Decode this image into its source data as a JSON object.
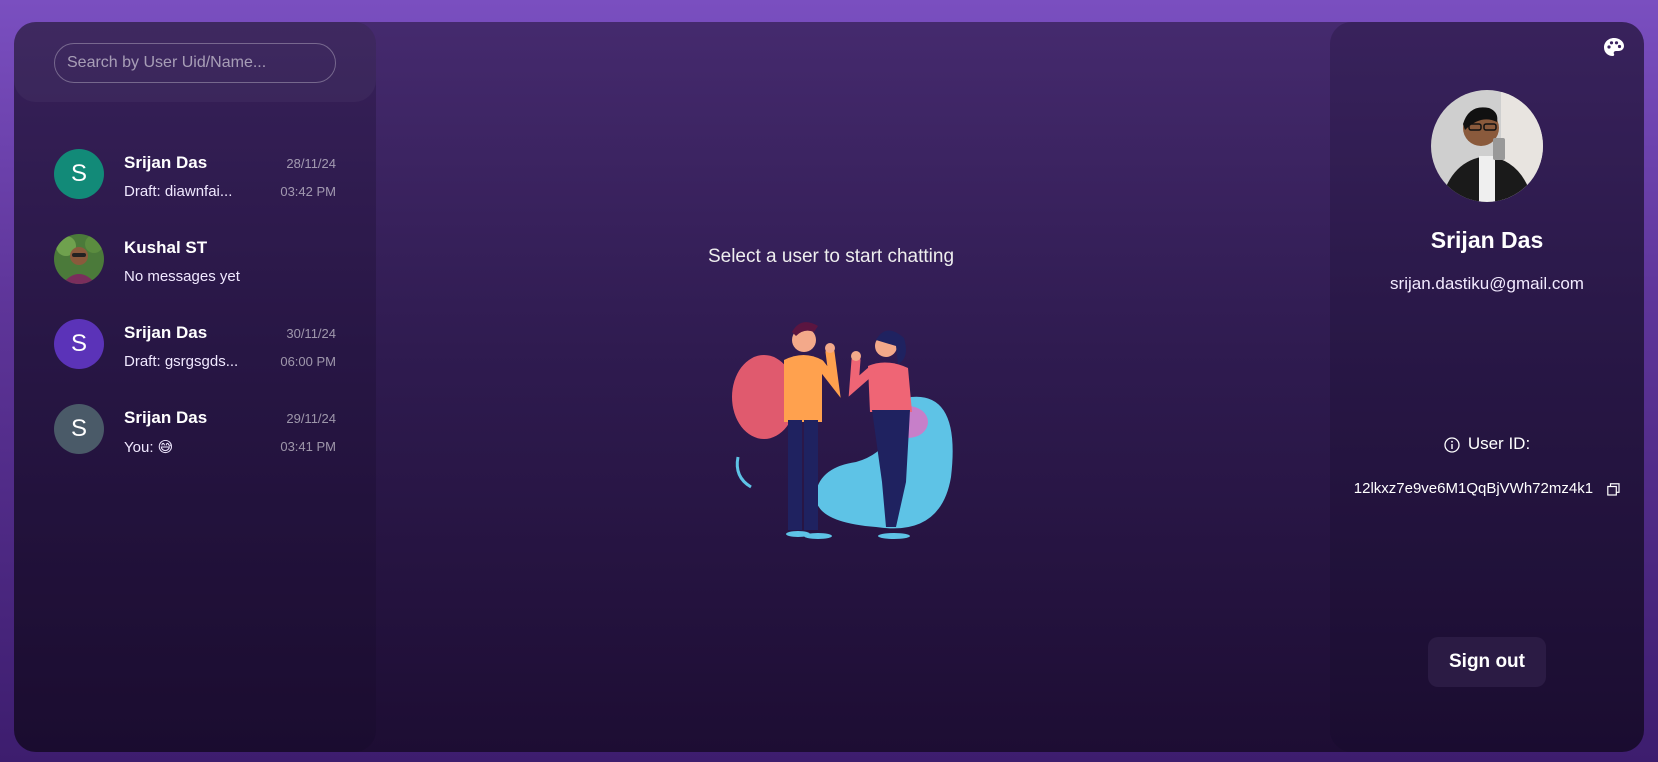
{
  "search": {
    "placeholder": "Search by User Uid/Name..."
  },
  "chats": [
    {
      "name": "Srijan Das",
      "preview": "Draft: diawnfai...",
      "date": "28/11/24",
      "time": "03:42 PM",
      "initial": "S",
      "avatar_color": "#128a78"
    },
    {
      "name": "Kushal ST",
      "preview": "No messages yet",
      "date": "",
      "time": "",
      "initial": "",
      "avatar_color": "#4b7a3a"
    },
    {
      "name": "Srijan Das",
      "preview": "Draft: gsrgsgds...",
      "date": "30/11/24",
      "time": "06:00 PM",
      "initial": "S",
      "avatar_color": "#5b33b8"
    },
    {
      "name": "Srijan Das",
      "preview": "You: 😅",
      "date": "29/11/24",
      "time": "03:41 PM",
      "initial": "S",
      "avatar_color": "#4a5a68"
    }
  ],
  "center": {
    "message": "Select a user to start chatting"
  },
  "profile": {
    "name": "Srijan Das",
    "email": "srijan.dastiku@gmail.com",
    "uid_label": "User ID:",
    "uid": "12lkxz7e9ve6M1QqBjVWh72mz4k1",
    "signout_label": "Sign out"
  },
  "colors": {
    "accent": "#7a4fc0",
    "signout_bg": "#2b1b44"
  }
}
